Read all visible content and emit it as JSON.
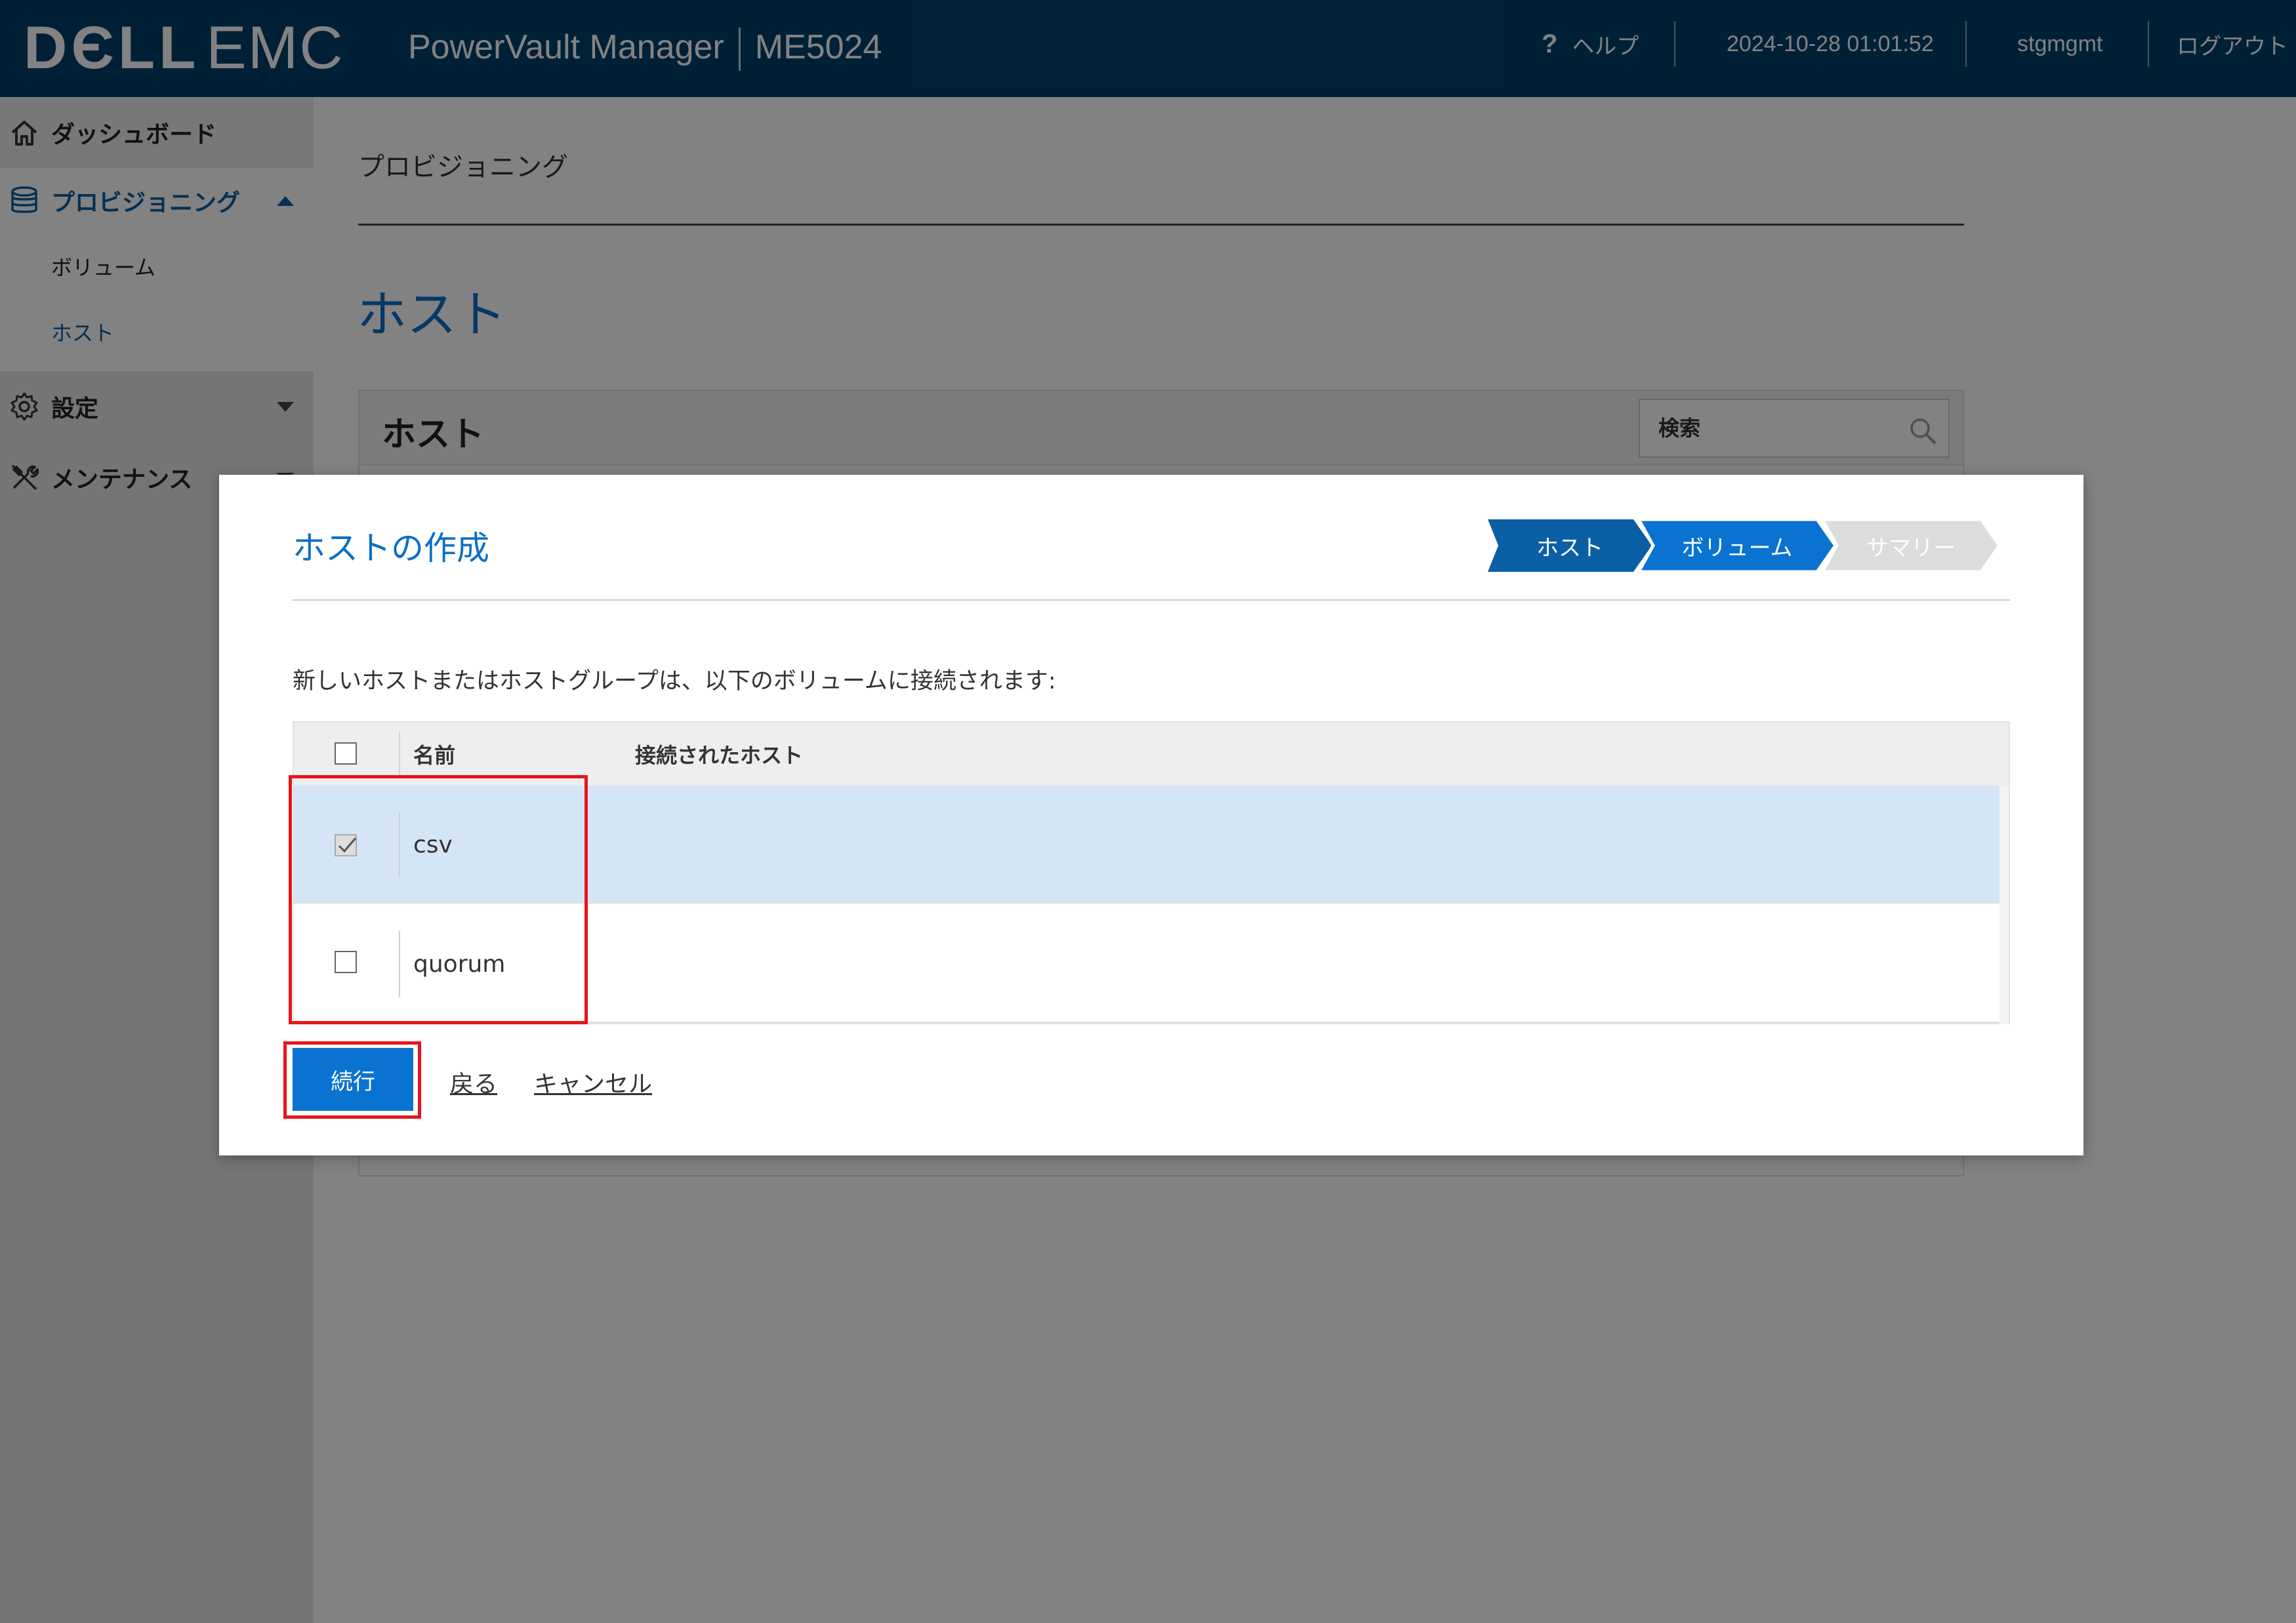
{
  "header": {
    "logo_dell": "DЄLL",
    "logo_emc": "EMC",
    "product": "PowerVault Manager",
    "model": "ME5024",
    "help": "ヘルプ",
    "help_symbol": "?",
    "datetime": "2024-10-28 01:01:52",
    "user": "stgmgmt",
    "logout": "ログアウト"
  },
  "sidebar": {
    "items": [
      {
        "label": "ダッシュボード",
        "icon": "home-icon"
      },
      {
        "label": "プロビジョニング",
        "icon": "database-icon",
        "expanded": true
      },
      {
        "label": "ボリューム"
      },
      {
        "label": "ホスト",
        "selected": true
      },
      {
        "label": "設定",
        "icon": "gear-icon"
      },
      {
        "label": "メンテナンス",
        "icon": "tools-icon"
      }
    ]
  },
  "main": {
    "breadcrumb": "プロビジョニング",
    "title": "ホスト",
    "panel_title": "ホスト",
    "search_placeholder": "検索"
  },
  "dialog": {
    "title": "ホストの作成",
    "steps": [
      "ホスト",
      "ボリューム",
      "サマリー"
    ],
    "description": "新しいホストまたはホストグループは、以下のボリュームに接続されます:",
    "table": {
      "columns": [
        "名前",
        "接続されたホスト"
      ],
      "rows": [
        {
          "name": "csv",
          "hosts": "",
          "checked": true
        },
        {
          "name": "quorum",
          "hosts": "",
          "checked": false
        }
      ]
    },
    "continue_label": "続行",
    "back_label": "戻る",
    "cancel_label": "キャンセル"
  },
  "colors": {
    "header_bg": "#00406b",
    "accent": "#0b6fc6",
    "primary_button": "#0a73d1",
    "highlight": "#e8141b",
    "selected_row": "#d4e6f6"
  }
}
